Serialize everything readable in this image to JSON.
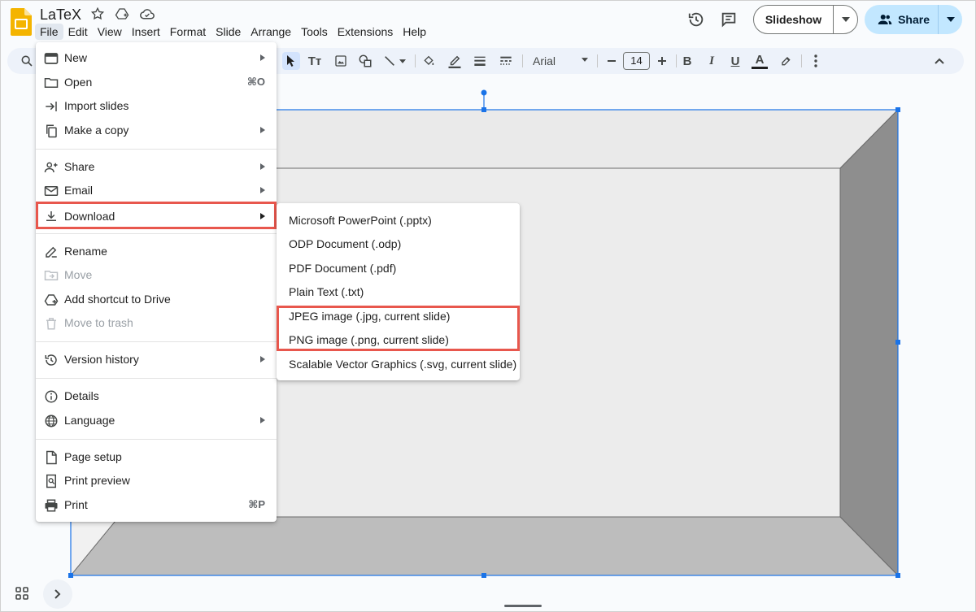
{
  "app": {
    "title": "LaTeX"
  },
  "menubar": [
    "File",
    "Edit",
    "View",
    "Insert",
    "Format",
    "Slide",
    "Arrange",
    "Tools",
    "Extensions",
    "Help"
  ],
  "header_actions": {
    "slideshow_label": "Slideshow",
    "share_label": "Share"
  },
  "toolbar": {
    "font_name": "Arial",
    "font_size": "14",
    "text_icon_label": "Tт",
    "bold": "B",
    "italic": "I",
    "underline": "U",
    "text_color": "A"
  },
  "file_menu": {
    "new": "New",
    "open": "Open",
    "open_shortcut": "⌘O",
    "import_slides": "Import slides",
    "make_copy": "Make a copy",
    "share": "Share",
    "email": "Email",
    "download": "Download",
    "rename": "Rename",
    "move": "Move",
    "add_shortcut": "Add shortcut to Drive",
    "move_to_trash": "Move to trash",
    "version_history": "Version history",
    "details": "Details",
    "language": "Language",
    "page_setup": "Page setup",
    "print_preview": "Print preview",
    "print": "Print",
    "print_shortcut": "⌘P"
  },
  "download_submenu": [
    "Microsoft PowerPoint (.pptx)",
    "ODP Document (.odp)",
    "PDF Document (.pdf)",
    "Plain Text (.txt)",
    "JPEG image (.jpg, current slide)",
    "PNG image (.png, current slide)",
    "Scalable Vector Graphics (.svg, current slide)"
  ],
  "colors": {
    "highlight": "#e8574d",
    "share_bg": "#c2e7ff",
    "toolbar_bg": "#edf2fa",
    "selection": "#1a73e8",
    "slides_yellow": "#f4b400"
  }
}
